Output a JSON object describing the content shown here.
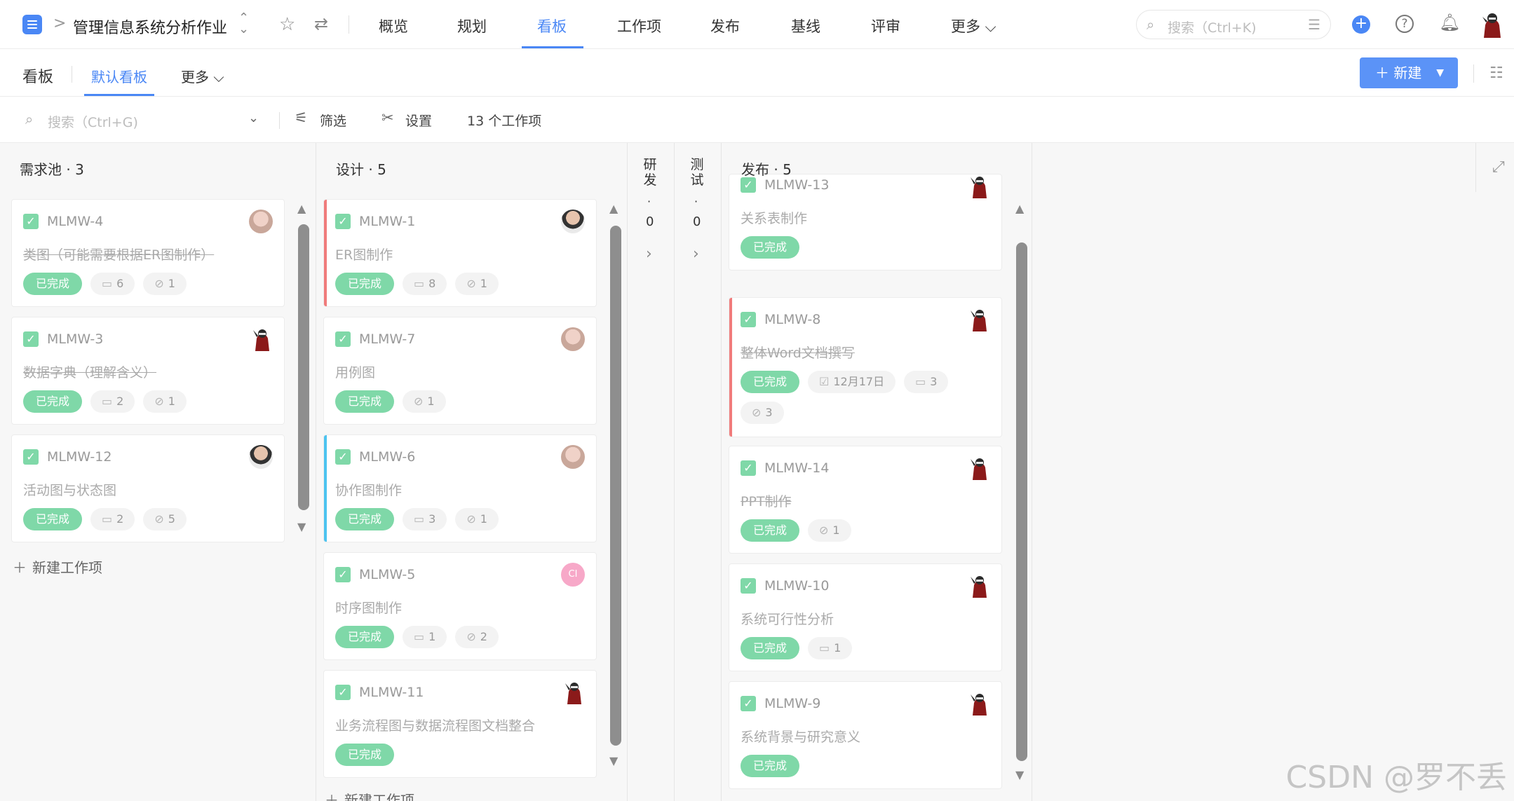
{
  "topnav": {
    "crumb_sep": ">",
    "project_title": "管理信息系统分析作业",
    "tabs": [
      "概览",
      "规划",
      "看板",
      "工作项",
      "发布",
      "基线",
      "评审",
      "更多 ⌵"
    ],
    "active_tab": "看板",
    "search_placeholder": "搜索（Ctrl+K)"
  },
  "subhead": {
    "title": "看板",
    "tabs": [
      "默认看板",
      "更多 ⌵"
    ],
    "new_button": "新建"
  },
  "toolbar": {
    "search_placeholder": "搜索（Ctrl+G)",
    "filter": "筛选",
    "settings": "设置",
    "count": "13 个工作项"
  },
  "columns": {
    "backlog": {
      "title": "需求池 · 3",
      "add": "新建工作项"
    },
    "design": {
      "title": "设计 · 5",
      "add": "新建工作项"
    },
    "dev": {
      "label": "研发",
      "dot": "·",
      "count": "0"
    },
    "test": {
      "label": "测试",
      "dot": "·",
      "count": "0"
    },
    "release": {
      "title": "发布 · 5"
    }
  },
  "cards": {
    "b1": {
      "id": "MLMW-4",
      "title": "类图（可能需要根据ER图制作）",
      "status": "已完成",
      "comments": "6",
      "attach": "1"
    },
    "b2": {
      "id": "MLMW-3",
      "title": "数据字典（理解含义）",
      "status": "已完成",
      "comments": "2",
      "attach": "1"
    },
    "b3": {
      "id": "MLMW-12",
      "title": "活动图与状态图",
      "status": "已完成",
      "comments": "2",
      "attach": "5"
    },
    "d1": {
      "id": "MLMW-1",
      "title": "ER图制作",
      "status": "已完成",
      "comments": "8",
      "attach": "1"
    },
    "d2": {
      "id": "MLMW-7",
      "title": "用例图",
      "status": "已完成",
      "attach": "1"
    },
    "d3": {
      "id": "MLMW-6",
      "title": "协作图制作",
      "status": "已完成",
      "comments": "3",
      "attach": "1"
    },
    "d4": {
      "id": "MLMW-5",
      "title": "时序图制作",
      "status": "已完成",
      "comments": "1",
      "attach": "2",
      "avatar": "CI"
    },
    "d5": {
      "id": "MLMW-11",
      "title": "业务流程图与数据流程图文档整合",
      "status": "已完成"
    },
    "r1": {
      "id": "MLMW-13",
      "title": "关系表制作",
      "status": "已完成"
    },
    "r2": {
      "id": "MLMW-8",
      "title": "整体Word文档撰写",
      "status": "已完成",
      "date": "12月17日",
      "comments": "3",
      "attach": "3"
    },
    "r3": {
      "id": "MLMW-14",
      "title": "PPT制作",
      "status": "已完成",
      "attach": "1"
    },
    "r4": {
      "id": "MLMW-10",
      "title": "系统可行性分析",
      "status": "已完成",
      "comments": "1"
    },
    "r5": {
      "id": "MLMW-9",
      "title": "系统背景与研究意义",
      "status": "已完成"
    }
  },
  "watermark": "CSDN @罗不丢",
  "colors": {
    "accent": "#4a87f5",
    "done": "#7fd8a8",
    "red_bar": "#f07b7b",
    "blue_bar": "#4cc3f0"
  }
}
